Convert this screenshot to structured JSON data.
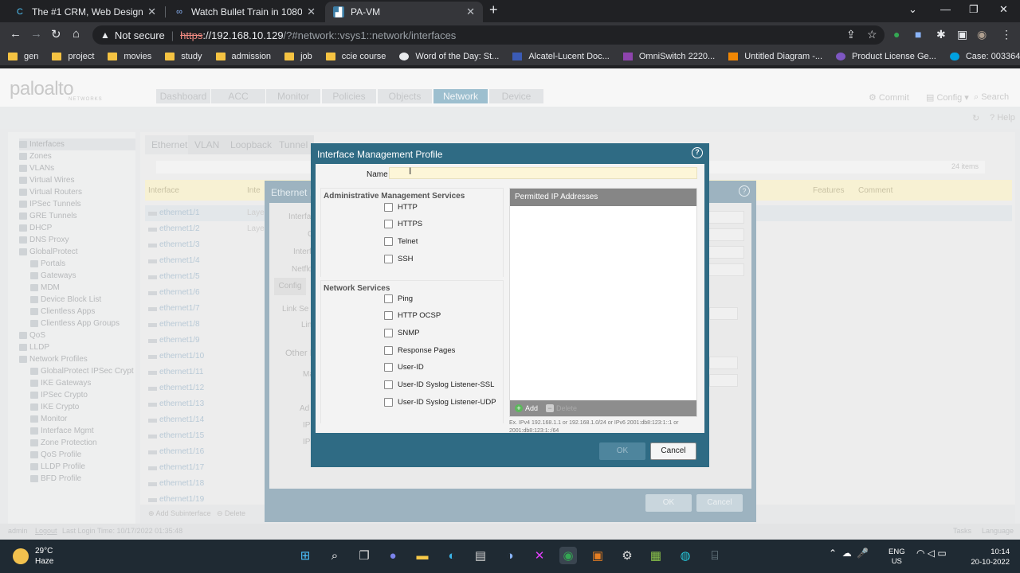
{
  "browser": {
    "tabs": [
      {
        "title": "The #1 CRM, Web Design and Pl",
        "icon": "crm-favicon"
      },
      {
        "title": "Watch Bullet Train in 1080p on S",
        "icon": "video-favicon"
      },
      {
        "title": "PA-VM",
        "icon": "paloalto-favicon"
      }
    ],
    "address": {
      "warning": "Not secure",
      "scheme": "https",
      "host": "://192.168.10.129",
      "path": "/?#network::vsys1::network/interfaces"
    },
    "bookmarks": [
      {
        "label": "gen",
        "icon": "folder-icon"
      },
      {
        "label": "project",
        "icon": "folder-icon"
      },
      {
        "label": "movies",
        "icon": "folder-icon"
      },
      {
        "label": "study",
        "icon": "folder-icon"
      },
      {
        "label": "admission",
        "icon": "folder-icon"
      },
      {
        "label": "job",
        "icon": "folder-icon"
      },
      {
        "label": "ccie course",
        "icon": "folder-icon"
      },
      {
        "label": "Word of the Day: St...",
        "icon": "globe-icon"
      },
      {
        "label": "Alcatel-Lucent Doc...",
        "icon": "n-icon"
      },
      {
        "label": "OmniSwitch 2220...",
        "icon": "doc-icon"
      },
      {
        "label": "Untitled Diagram -...",
        "icon": "diagram-icon"
      },
      {
        "label": "Product License Ge...",
        "icon": "license-icon"
      },
      {
        "label": "Case: 00336464 - C...",
        "icon": "cloud-icon"
      }
    ]
  },
  "app": {
    "logo": "paloalto",
    "logo_sub": "NETWORKS",
    "nav_tabs": [
      "Dashboard",
      "ACC",
      "Monitor",
      "Policies",
      "Objects",
      "Network",
      "Device"
    ],
    "active_tab": "Network",
    "header_tools": {
      "commit": "Commit",
      "config": "Config",
      "search": "Search",
      "help": "Help"
    },
    "sidebar": [
      {
        "label": "Interfaces"
      },
      {
        "label": "Zones"
      },
      {
        "label": "VLANs"
      },
      {
        "label": "Virtual Wires"
      },
      {
        "label": "Virtual Routers"
      },
      {
        "label": "IPSec Tunnels"
      },
      {
        "label": "GRE Tunnels"
      },
      {
        "label": "DHCP"
      },
      {
        "label": "DNS Proxy"
      },
      {
        "label": "GlobalProtect"
      },
      {
        "label": "Portals"
      },
      {
        "label": "Gateways"
      },
      {
        "label": "MDM"
      },
      {
        "label": "Device Block List"
      },
      {
        "label": "Clientless Apps"
      },
      {
        "label": "Clientless App Groups"
      },
      {
        "label": "QoS"
      },
      {
        "label": "LLDP"
      },
      {
        "label": "Network Profiles"
      },
      {
        "label": "GlobalProtect IPSec Crypt"
      },
      {
        "label": "IKE Gateways"
      },
      {
        "label": "IPSec Crypto"
      },
      {
        "label": "IKE Crypto"
      },
      {
        "label": "Monitor"
      },
      {
        "label": "Interface Mgmt"
      },
      {
        "label": "Zone Protection"
      },
      {
        "label": "QoS Profile"
      },
      {
        "label": "LLDP Profile"
      },
      {
        "label": "BFD Profile"
      }
    ],
    "main_tabs": [
      "Ethernet",
      "VLAN",
      "Loopback",
      "Tunnel"
    ],
    "item_count": "24 items",
    "grid_headers": {
      "interface": "Interface",
      "interface_type": "Inte",
      "features": "Features",
      "comment": "Comment"
    },
    "rows": [
      {
        "name": "ethernet1/1",
        "type": "Layer"
      },
      {
        "name": "ethernet1/2",
        "type": "Layer"
      },
      {
        "name": "ethernet1/3",
        "type": ""
      },
      {
        "name": "ethernet1/4",
        "type": ""
      },
      {
        "name": "ethernet1/5",
        "type": ""
      },
      {
        "name": "ethernet1/6",
        "type": ""
      },
      {
        "name": "ethernet1/7",
        "type": ""
      },
      {
        "name": "ethernet1/8",
        "type": ""
      },
      {
        "name": "ethernet1/9",
        "type": ""
      },
      {
        "name": "ethernet1/10",
        "type": ""
      },
      {
        "name": "ethernet1/11",
        "type": ""
      },
      {
        "name": "ethernet1/12",
        "type": ""
      },
      {
        "name": "ethernet1/13",
        "type": ""
      },
      {
        "name": "ethernet1/14",
        "type": ""
      },
      {
        "name": "ethernet1/15",
        "type": ""
      },
      {
        "name": "ethernet1/16",
        "type": ""
      },
      {
        "name": "ethernet1/17",
        "type": ""
      },
      {
        "name": "ethernet1/18",
        "type": ""
      },
      {
        "name": "ethernet1/19",
        "type": ""
      }
    ],
    "footer": {
      "add_subinterface": "Add Subinterface",
      "delete": "Delete"
    },
    "status": {
      "user": "admin",
      "logout": "Logout",
      "last_login": "Last Login Time: 10/17/2022 01:35:48",
      "tasks": "Tasks",
      "language": "Language"
    }
  },
  "eth_dialog": {
    "title": "Ethernet In",
    "labels": [
      "Interfa",
      "C",
      "Interf",
      "Netflo"
    ],
    "tab": "Config",
    "section1": "Link Se",
    "sub1": "Lin",
    "section2": "Other In",
    "sub2": "Ma",
    "adj": "Ad",
    "ip1": "IP",
    "ip2": "IP",
    "ok": "OK",
    "cancel": "Cancel"
  },
  "dialog": {
    "title": "Interface Management Profile",
    "name_label": "Name",
    "name_value": "",
    "admin_section": "Administrative Management Services",
    "admin_services": [
      {
        "label": "HTTP",
        "checked": false
      },
      {
        "label": "HTTPS",
        "checked": false
      },
      {
        "label": "Telnet",
        "checked": false
      },
      {
        "label": "SSH",
        "checked": false
      }
    ],
    "network_section": "Network Services",
    "network_services": [
      {
        "label": "Ping",
        "checked": false
      },
      {
        "label": "HTTP OCSP",
        "checked": false
      },
      {
        "label": "SNMP",
        "checked": false
      },
      {
        "label": "Response Pages",
        "checked": false
      },
      {
        "label": "User-ID",
        "checked": false
      },
      {
        "label": "User-ID Syslog Listener-SSL",
        "checked": false
      },
      {
        "label": "User-ID Syslog Listener-UDP",
        "checked": false
      }
    ],
    "permitted_ip_header": "Permitted IP Addresses",
    "add_label": "Add",
    "delete_label": "Delete",
    "hint": "Ex. IPv4 192.168.1.1 or 192.168.1.0/24 or IPv6 2001:db8:123:1::1 or 2001:db8:123:1::/64",
    "ok_label": "OK",
    "cancel_label": "Cancel"
  },
  "taskbar": {
    "weather_temp": "29°C",
    "weather_desc": "Haze",
    "lang_line1": "ENG",
    "lang_line2": "US",
    "time": "10:14",
    "date": "20-10-2022"
  },
  "colors": {
    "dialog_frame": "#2f6b84",
    "name_field": "#fdf6d8",
    "ip_header": "#868686"
  }
}
